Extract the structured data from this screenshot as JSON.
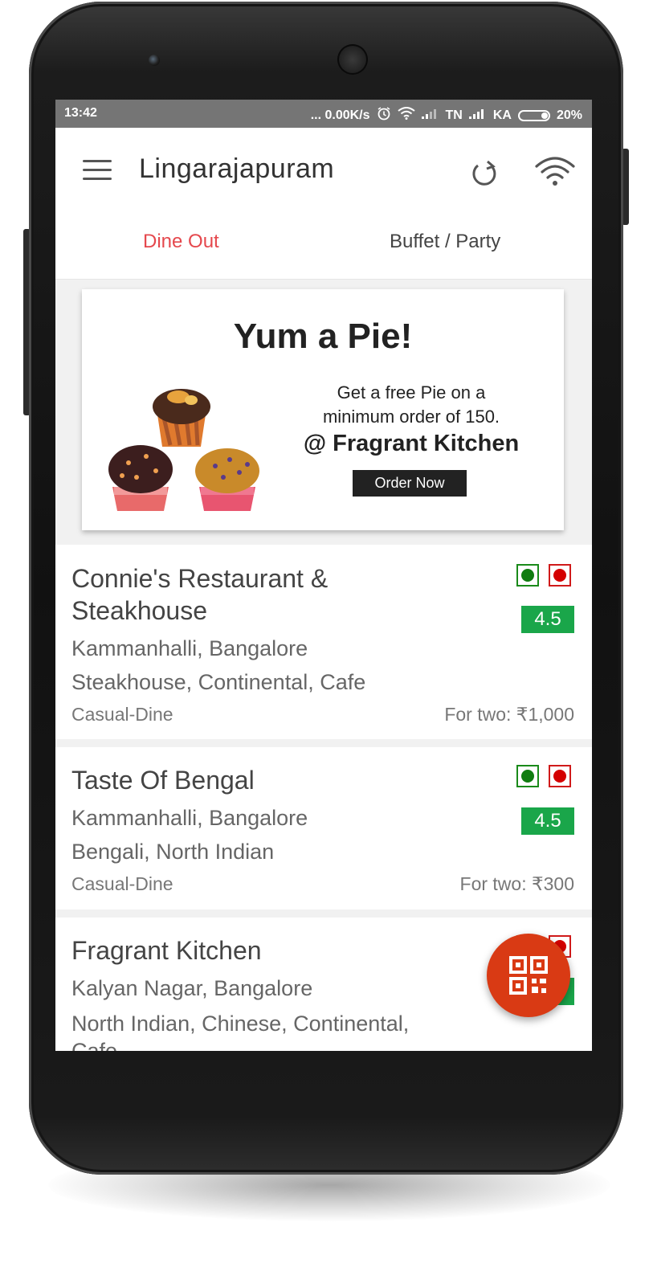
{
  "status_bar": {
    "time": "13:42",
    "indicators": "... 0.00K/s",
    "carrier_1": "TN",
    "carrier_2": "KA",
    "battery": "20%"
  },
  "header": {
    "location": "Lingarajapuram",
    "menu_icon": "hamburger-menu-icon",
    "refresh_icon": "refresh-icon",
    "wifi_icon": "wifi-icon"
  },
  "tabs": [
    {
      "label": "Dine Out",
      "active": true,
      "color": "#e5484d"
    },
    {
      "label": "Buffet / Party",
      "active": false
    }
  ],
  "banner": {
    "title": "Yum a Pie!",
    "text_line_1": "Get a free Pie on a",
    "text_line_2": "minimum order of 150.",
    "brand": "@ Fragrant Kitchen",
    "button": "Order Now"
  },
  "restaurants": [
    {
      "name": "Connie's Restaurant & Steakhouse",
      "location": "Kammanhalli, Bangalore",
      "cuisines": "Steakhouse, Continental, Cafe",
      "type": "Casual-Dine",
      "price": "For two: ₹1,000",
      "rating": "4.5"
    },
    {
      "name": "Taste Of Bengal",
      "location": "Kammanhalli, Bangalore",
      "cuisines": "Bengali, North Indian",
      "type": "Casual-Dine",
      "price": "For two: ₹300",
      "rating": "4.5"
    },
    {
      "name": "Fragrant Kitchen",
      "location": "Kalyan Nagar, Bangalore",
      "cuisines": "North Indian, Chinese, Continental, Cafe"
    }
  ],
  "fab": {
    "icon": "qr-code-icon",
    "color": "#d93a14"
  },
  "colors": {
    "veg": "#107c10",
    "non_veg": "#d40000",
    "rating": "#1aa64a",
    "accent": "#e5484d"
  }
}
